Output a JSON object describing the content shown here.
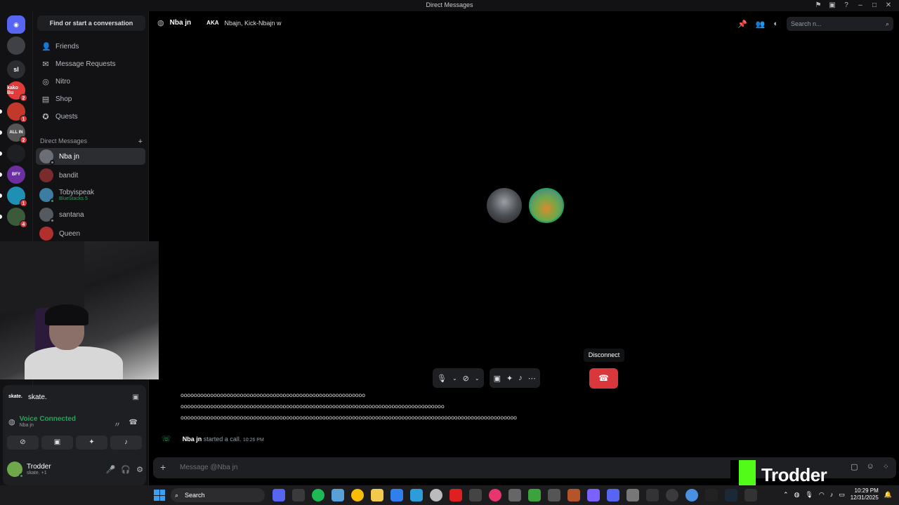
{
  "window": {
    "title": "Direct Messages"
  },
  "sidebar": {
    "find_label": "Find or start a conversation",
    "nav": [
      {
        "label": "Friends",
        "icon": "friends-icon"
      },
      {
        "label": "Message Requests",
        "icon": "mail-icon"
      },
      {
        "label": "Nitro",
        "icon": "nitro-icon"
      },
      {
        "label": "Shop",
        "icon": "shop-icon"
      },
      {
        "label": "Quests",
        "icon": "quests-icon"
      }
    ],
    "dm_header": "Direct Messages",
    "dm_add": "+",
    "dms": [
      {
        "name": "Nba jn",
        "sub": ""
      },
      {
        "name": "bandit",
        "sub": ""
      },
      {
        "name": "Tobyispeak",
        "sub": "BlueStacks 5"
      },
      {
        "name": "santana",
        "sub": ""
      },
      {
        "name": "Queen",
        "sub": ""
      }
    ]
  },
  "servers": [
    {
      "label": "",
      "badge": ""
    },
    {
      "label": "sl",
      "badge": ""
    },
    {
      "label": "kako Bu",
      "badge": "2"
    },
    {
      "label": "",
      "badge": "1"
    },
    {
      "label": "ALL IN",
      "badge": "2"
    },
    {
      "label": "",
      "badge": ""
    },
    {
      "label": "BFY",
      "badge": ""
    },
    {
      "label": "",
      "badge": "1"
    },
    {
      "label": "",
      "badge": "4"
    }
  ],
  "voice_panel": {
    "server_logo": "skate.",
    "server_name": "skate.",
    "status": "Voice Connected",
    "channel": "Nba jn",
    "user_name": "Trodder",
    "user_status": "skate. +1"
  },
  "header": {
    "name": "Nba jn",
    "aka_label": "AKA",
    "aliases": "Nbajn, Kick-Nbajn w",
    "search_placeholder": "Search n..."
  },
  "call": {
    "tooltip": "Disconnect"
  },
  "messages": {
    "lines": [
      "oooooooooooooooooooooooooooooooooooooooooooooooooooooooo",
      "oooooooooooooooooooooooooooooooooooooooooooooooooooooooooooooooooooooooooooooooo",
      "oooooooooooooooooooooooooooooooooooooooooooooooooooooooooooooooooooooooooooooooooooooooooooooooooooooo"
    ],
    "call_event": {
      "who": "Nba jn",
      "text": "started a call.",
      "time": "10:26 PM"
    }
  },
  "composer": {
    "placeholder": "Message @Nba jn"
  },
  "watermark": {
    "name": "Trodder"
  },
  "taskbar": {
    "search_label": "Search",
    "time": "10:29 PM",
    "date": "12/31/2025"
  },
  "colors": {
    "accent_green": "#23a55a",
    "danger": "#da373c",
    "kick_green": "#53fc18",
    "discord_blurple": "#5865f2"
  }
}
